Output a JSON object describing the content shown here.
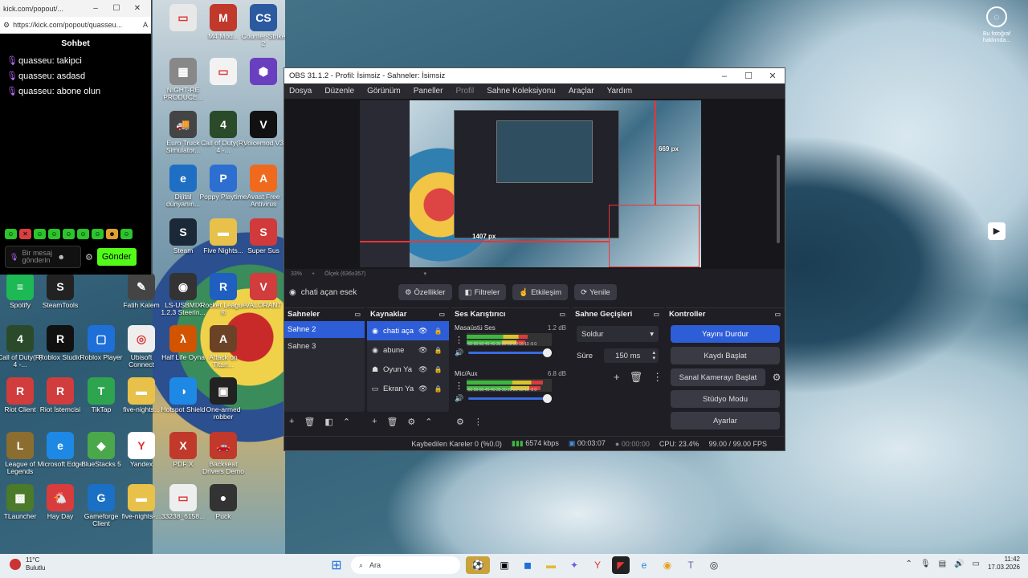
{
  "chat_window": {
    "title": "kick.com/popout/...",
    "url": "https://kick.com/popout/quasseu...",
    "header": "Sohbet",
    "messages": [
      {
        "user": "quasseu:",
        "text": "takipci"
      },
      {
        "user": "quasseu:",
        "text": "asdasd"
      },
      {
        "user": "quasseu:",
        "text": "abone olun"
      }
    ],
    "input_placeholder": "Bir mesaj gönderin",
    "send_label": "Gönder"
  },
  "desktop_icons": [
    {
      "label": "",
      "color": "#e8e8e8",
      "glyph": "▭"
    },
    {
      "label": "M4 Mod...",
      "color": "#c0392b",
      "glyph": "M"
    },
    {
      "label": "Counter-Strike 2",
      "color": "#2c5aa0",
      "glyph": "CS"
    },
    {
      "label": "NIGHT-RE PRODUCE...",
      "color": "#888",
      "glyph": "▦"
    },
    {
      "label": "",
      "color": "#f2f2f2",
      "glyph": "▭"
    },
    {
      "label": "",
      "color": "#6a3fbf",
      "glyph": "⬢"
    },
    {
      "label": "Euro Truck Simulator...",
      "color": "#444",
      "glyph": "🚚"
    },
    {
      "label": "Call of Duty(R) 4 -...",
      "color": "#2a4a2a",
      "glyph": "4"
    },
    {
      "label": "Voicemod V3",
      "color": "#111",
      "glyph": "V"
    },
    {
      "label": "Dijital dünyanın...",
      "color": "#1e6fc4",
      "glyph": "e"
    },
    {
      "label": "Poppy Playtime",
      "color": "#2d6fd0",
      "glyph": "P"
    },
    {
      "label": "Avast Free Antivirus",
      "color": "#f06a1e",
      "glyph": "A"
    },
    {
      "label": "Steam",
      "color": "#1b2838",
      "glyph": "S"
    },
    {
      "label": "Five Nights...",
      "color": "#e8c14a",
      "glyph": "▬"
    },
    {
      "label": "Super Sus",
      "color": "#d03a3a",
      "glyph": "S"
    },
    {
      "label": "Spotify",
      "color": "#1db954",
      "glyph": "≡"
    },
    {
      "label": "SteamTools",
      "color": "#222",
      "glyph": "S"
    },
    {
      "label": "Fatih Kalem",
      "color": "#444",
      "glyph": "✎"
    },
    {
      "label": "LS-USBMIX 1.2.3 Steerin...",
      "color": "#333",
      "glyph": "◉"
    },
    {
      "label": "Rocket League ®",
      "color": "#1f5fbf",
      "glyph": "R"
    },
    {
      "label": "VALORANT",
      "color": "#d13c3c",
      "glyph": "V"
    },
    {
      "label": "Call of Duty(R) 4 -...",
      "color": "#2a4a2a",
      "glyph": "4"
    },
    {
      "label": "Roblox Studio",
      "color": "#111",
      "glyph": "R"
    },
    {
      "label": "Roblox Player",
      "color": "#1e6fd8",
      "glyph": "▢"
    },
    {
      "label": "Ubisoft Connect",
      "color": "#eee",
      "glyph": "◎"
    },
    {
      "label": "Half Life Oyna",
      "color": "#d35400",
      "glyph": "λ"
    },
    {
      "label": "Attack on Titan...",
      "color": "#6b4226",
      "glyph": "A"
    },
    {
      "label": "Riot Client",
      "color": "#d13c3c",
      "glyph": "R"
    },
    {
      "label": "Riot İstemcisi",
      "color": "#d13c3c",
      "glyph": "R"
    },
    {
      "label": "TikTap",
      "color": "#2ea44f",
      "glyph": "T"
    },
    {
      "label": "five-nights...",
      "color": "#e8c14a",
      "glyph": "▬"
    },
    {
      "label": "Hotspot Shield",
      "color": "#1e88e5",
      "glyph": "◑"
    },
    {
      "label": "One-armed robber",
      "color": "#222",
      "glyph": "▣"
    },
    {
      "label": "League of Legends",
      "color": "#8b6d2f",
      "glyph": "L"
    },
    {
      "label": "Microsoft Edge",
      "color": "#1e88e5",
      "glyph": "e"
    },
    {
      "label": "BlueStacks 5",
      "color": "#4aa84a",
      "glyph": "◆"
    },
    {
      "label": "Yandex",
      "color": "#fff",
      "glyph": "Y"
    },
    {
      "label": "PDF X",
      "color": "#c0392b",
      "glyph": "X"
    },
    {
      "label": "Backseat Drivers Demo",
      "color": "#c0392b",
      "glyph": "🚗"
    },
    {
      "label": "TLauncher",
      "color": "#4a7a2a",
      "glyph": "▩"
    },
    {
      "label": "Hay Day",
      "color": "#d83c3c",
      "glyph": "🐔"
    },
    {
      "label": "Gameforge Client",
      "color": "#1a70c4",
      "glyph": "G"
    },
    {
      "label": "five-nights-...",
      "color": "#e8c14a",
      "glyph": "▬"
    },
    {
      "label": "33238_6158...",
      "color": "#eee",
      "glyph": "▭"
    },
    {
      "label": "Puck",
      "color": "#333",
      "glyph": "●"
    }
  ],
  "obs": {
    "title": "OBS 31.1.2 - Profil: İsimsiz - Sahneler: İsimsiz",
    "menu": [
      "Dosya",
      "Düzenle",
      "Görünüm",
      "Paneller",
      "Profil",
      "Sahne Koleksiyonu",
      "Araçlar",
      "Yardım"
    ],
    "preview": {
      "zoom": "33%",
      "scale": "Ölçek (636x357)",
      "width_label": "1407 px",
      "height_label": "669 px"
    },
    "source_toolbar": {
      "source_name": "chati açan esek",
      "buttons": [
        "Özellikler",
        "Filtreler",
        "Etkileşim",
        "Yenile"
      ]
    },
    "scenes": {
      "title": "Sahneler",
      "items": [
        "Sahne 2",
        "Sahne 3"
      ],
      "selected": 0
    },
    "sources": {
      "title": "Kaynaklar",
      "items": [
        {
          "name": "chati aça",
          "icon": "globe-icon"
        },
        {
          "name": "abune",
          "icon": "globe-icon"
        },
        {
          "name": "Oyun Ya",
          "icon": "gamepad-icon"
        },
        {
          "name": "Ekran Ya",
          "icon": "monitor-icon"
        }
      ],
      "selected": 0
    },
    "mixer": {
      "title": "Ses Karıştırıcı",
      "channels": [
        {
          "name": "Masaüstü Ses",
          "db": "1.2 dB",
          "level": 0.72
        },
        {
          "name": "Mic/Aux",
          "db": "6.8 dB",
          "level": 0.9
        }
      ],
      "ticks": "-60-55-50-45-40-35-30-25-20-15-10 -5 0"
    },
    "transitions": {
      "title": "Sahne Geçişleri",
      "type": "Soldur",
      "duration_label": "Süre",
      "duration": "150 ms"
    },
    "controls": {
      "title": "Kontroller",
      "buttons": [
        "Yayını Durdur",
        "Kaydı Başlat",
        "Sanal Kamerayı Başlat",
        "Stüdyo Modu",
        "Ayarlar"
      ]
    },
    "status": {
      "dropped": "Kaybedilen Kareler 0 (%0.0)",
      "bitrate": "6574 kbps",
      "stream_time": "00:03:07",
      "rec_time": "00:00:00",
      "cpu": "CPU: 23.4%",
      "fps": "99.00 / 99.00 FPS"
    }
  },
  "notification": {
    "label": "Bu fotoğraf hakkında..."
  },
  "taskbar": {
    "weather_temp": "11°C",
    "weather_desc": "Bulutlu",
    "search_placeholder": "Ara",
    "time": "11:42",
    "date": "17.03.2026"
  }
}
